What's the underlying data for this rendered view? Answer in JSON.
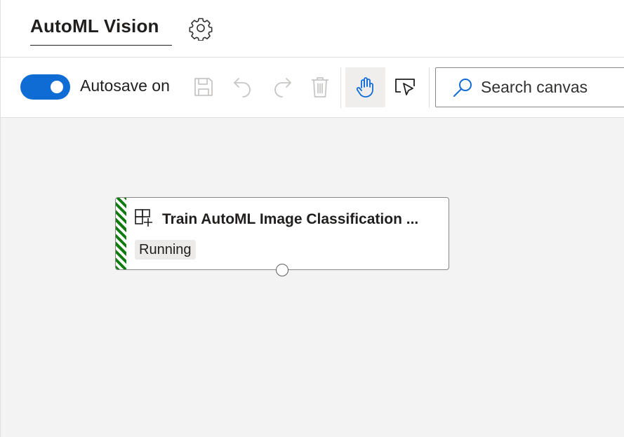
{
  "header": {
    "tab_title": "AutoML Vision",
    "settings_icon": "gear-icon"
  },
  "toolbar": {
    "autosave": {
      "label": "Autosave on",
      "on": true,
      "color": "#0f6cd5"
    },
    "icons": [
      "save-icon",
      "undo-icon",
      "redo-icon",
      "delete-icon",
      "hand-pan-icon",
      "select-pointer-icon"
    ],
    "search": {
      "placeholder": "Search canvas",
      "icon": "search-icon"
    }
  },
  "canvas": {
    "background": "#f3f3f3",
    "nodes": [
      {
        "title": "Train AutoML Image Classification ...",
        "status": "Running",
        "status_stripe_color": "#107c10",
        "icon": "module-add-icon"
      }
    ]
  }
}
